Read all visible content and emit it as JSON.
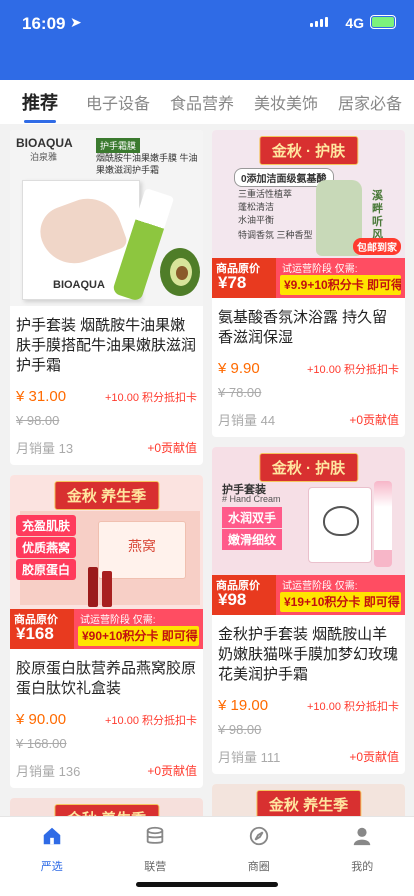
{
  "status": {
    "time": "16:09",
    "network": "4G"
  },
  "tabs": [
    "推荐",
    "电子设备",
    "食品营养",
    "美妆美饰",
    "居家必备"
  ],
  "left_col": [
    {
      "img": {
        "brand": "BIOAQUA",
        "brand_cn": "泊泉雅",
        "tag": "护手霜膜",
        "desc": "烟酰胺牛油果嫩手膜 牛油果嫩滋润护手霜"
      },
      "title": "护手套装 烟酰胺牛油果嫩肤手膜搭配牛油果嫩肤滋润护手霜",
      "price": "¥ 31.00",
      "bonus": "+10.00 积分抵扣卡",
      "orig": "¥ 98.00",
      "sold": "月销量 13",
      "contrib": "+0贡献值"
    },
    {
      "img": {
        "banner": "金秋 养生季",
        "chips": [
          "充盈肌肤",
          "优质燕窝",
          "胶原蛋白"
        ],
        "box": "燕窝",
        "pb_l1": "商品原价",
        "pb_l2": "¥168",
        "pb_r1": "试运营阶段 仅需:",
        "pb_r2": "¥90+10积分卡 即可得"
      },
      "title": "胶原蛋白肽营养品燕窝胶原蛋白肽饮礼盒装",
      "price": "¥ 90.00",
      "bonus": "+10.00 积分抵扣卡",
      "orig": "¥ 168.00",
      "sold": "月销量 136",
      "contrib": "+0贡献值"
    },
    {
      "img": {
        "banner": "金秋 养生季"
      }
    }
  ],
  "right_col": [
    {
      "img": {
        "banner": "金秋 · 护肤",
        "badge": "0添加洁面级氨基酸",
        "features": [
          "三重活性植萃",
          "蓬松清洁",
          "水油平衡",
          "特调香氛 三种香型"
        ],
        "side": "溪畔听风",
        "sticker": "包邮到家",
        "pb_l1": "商品原价",
        "pb_l2": "¥78",
        "pb_r1": "试运营阶段 仅需:",
        "pb_r2": "¥9.9+10积分卡 即可得"
      },
      "title": "氨基酸香氛沐浴露 持久留香滋润保湿",
      "price": "¥ 9.90",
      "bonus": "+10.00 积分抵扣卡",
      "orig": "¥ 78.00",
      "sold": "月销量 44",
      "contrib": "+0贡献值"
    },
    {
      "img": {
        "banner": "金秋 · 护肤",
        "kit": "护手套装",
        "kit_en": "# Hand Cream",
        "slogan1": "水润双手",
        "slogan2": "嫩滑细纹",
        "pb_l1": "商品原价",
        "pb_l2": "¥98",
        "pb_r1": "试运营阶段 仅需:",
        "pb_r2": "¥19+10积分卡 即可得"
      },
      "title": "金秋护手套装 烟酰胺山羊奶嫩肤猫咪手膜加梦幻玫瑰花美润护手霜",
      "price": "¥ 19.00",
      "bonus": "+10.00 积分抵扣卡",
      "orig": "¥ 98.00",
      "sold": "月销量 111",
      "contrib": "+0贡献值"
    },
    {
      "img": {
        "banner": "金秋 养生季"
      }
    }
  ],
  "nav": [
    "严选",
    "联营",
    "商圈",
    "我的"
  ],
  "colors": {
    "accent": "#2f6be6",
    "price": "#ff6a00",
    "promo": "#ff3b2f"
  }
}
